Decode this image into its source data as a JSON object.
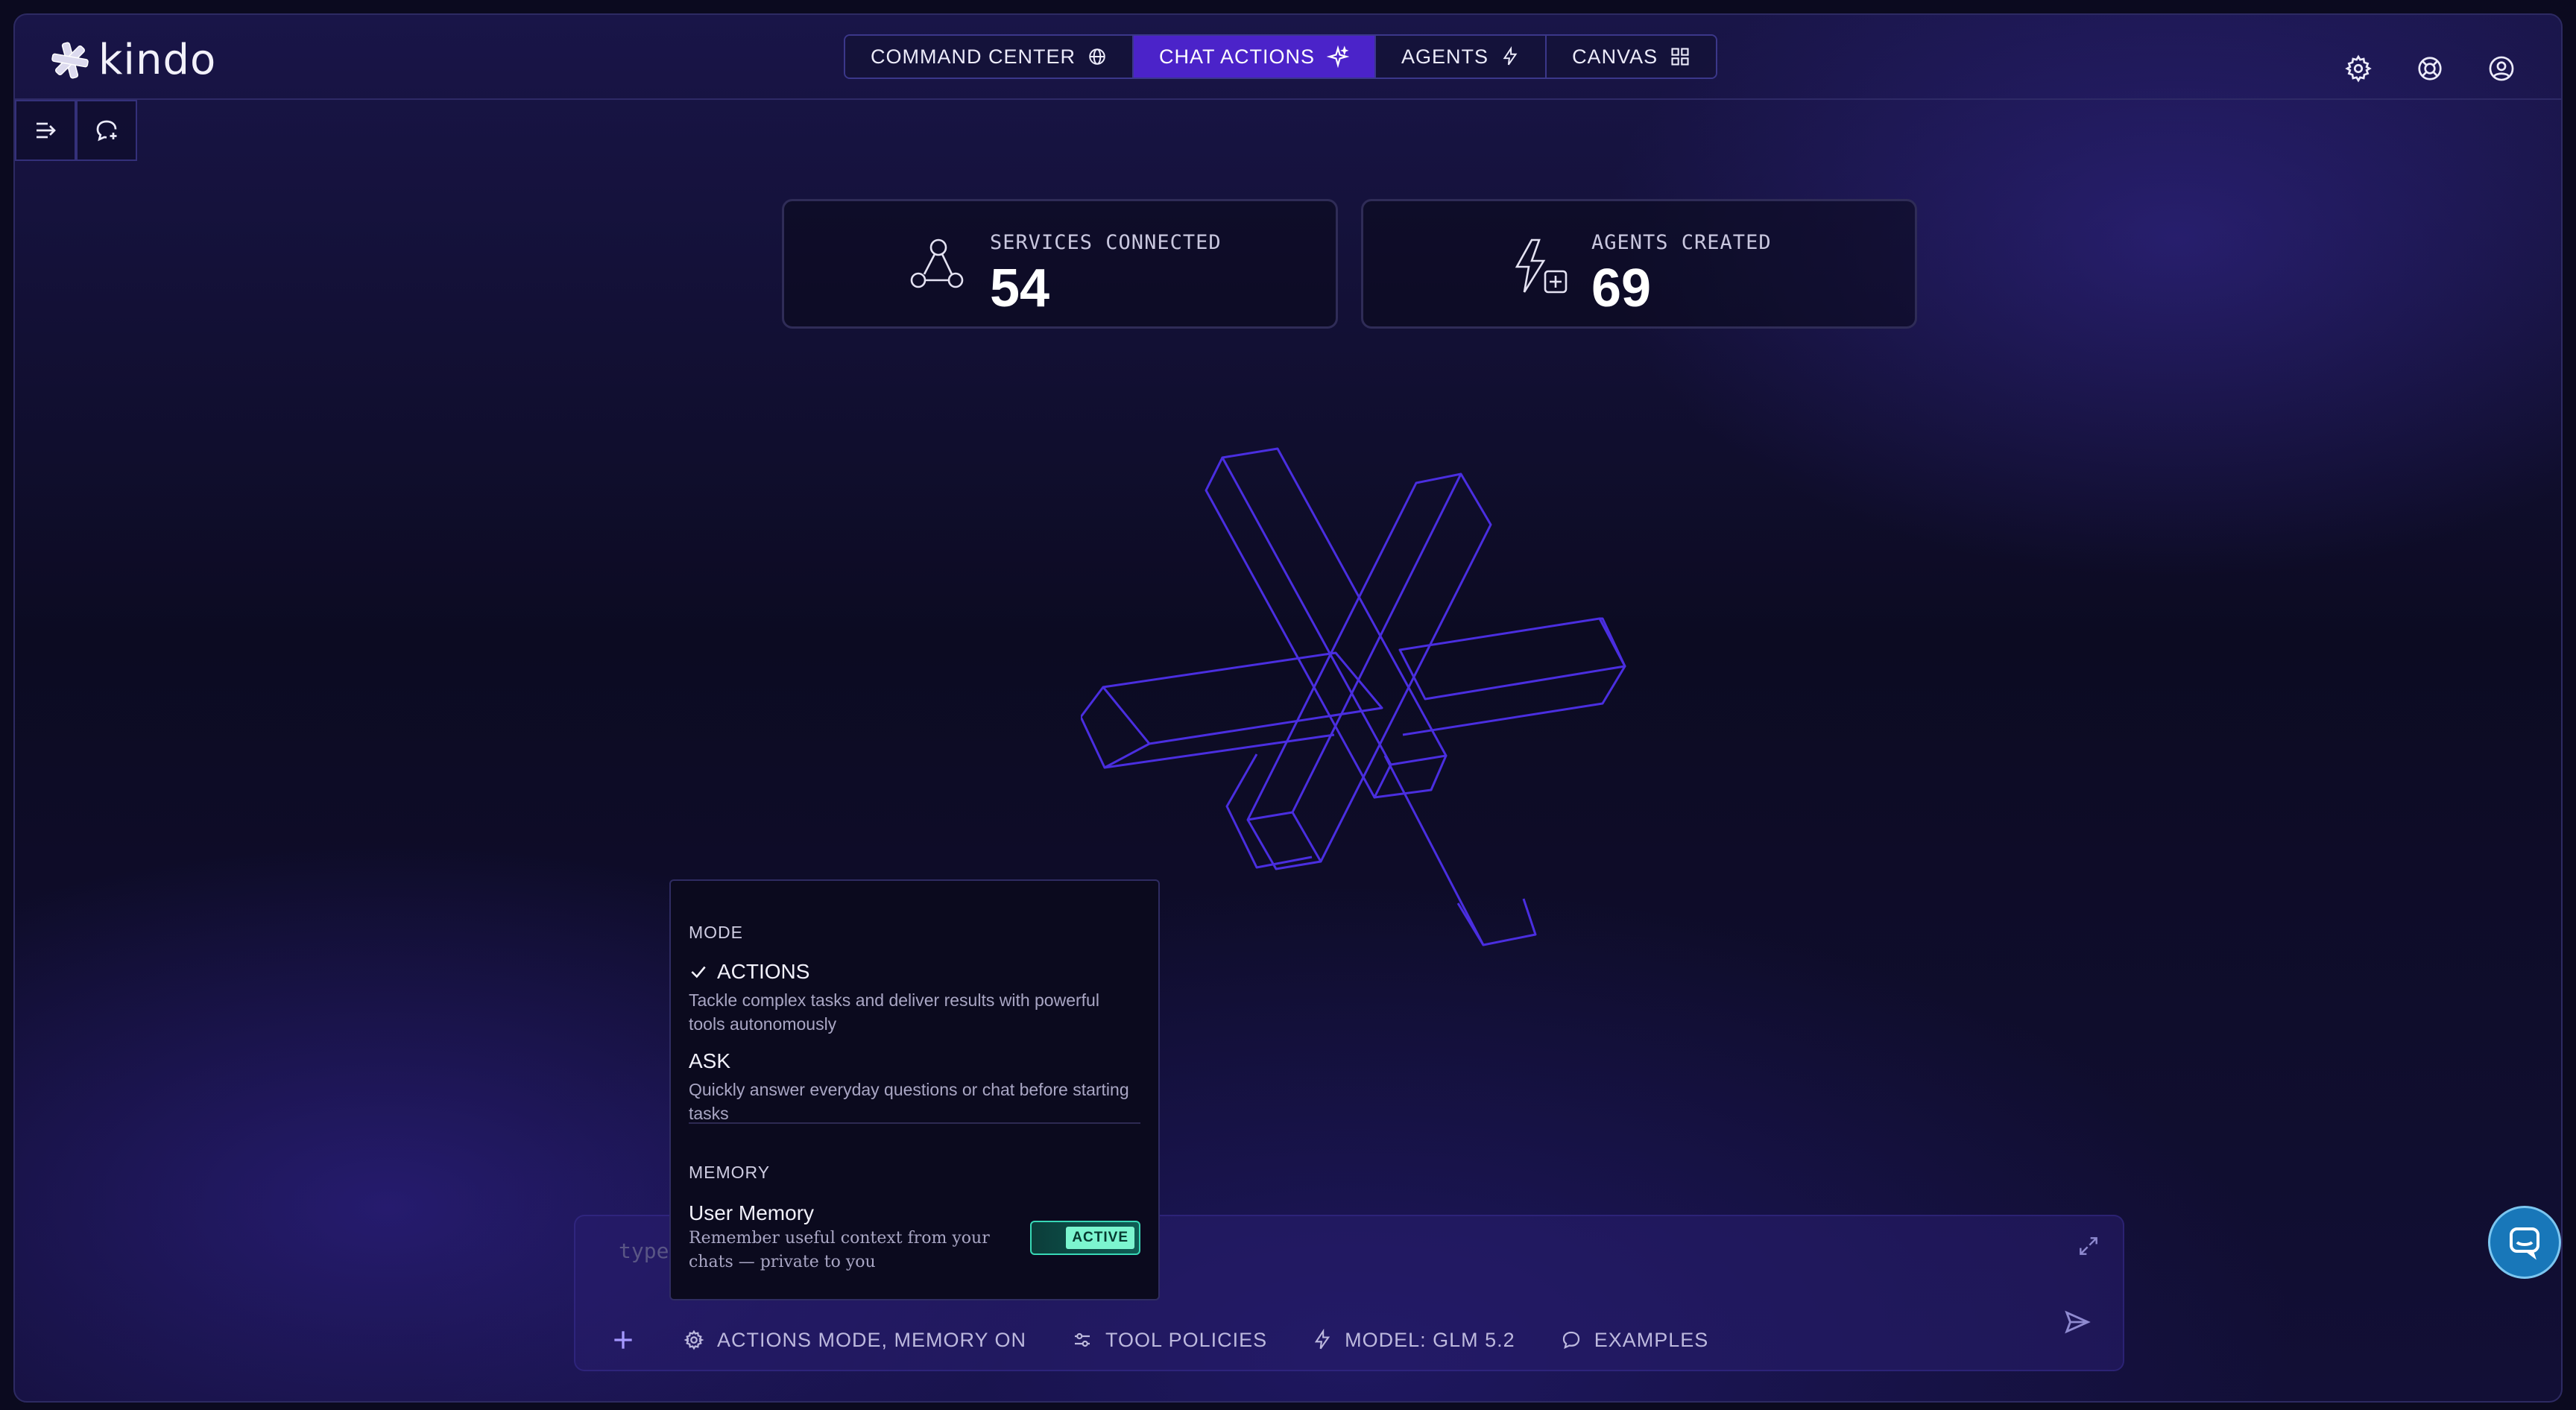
{
  "brand": {
    "logo_text": "kindo"
  },
  "nav": {
    "tabs": [
      {
        "label": "COMMAND CENTER",
        "icon": "globe-icon"
      },
      {
        "label": "CHAT ACTIONS",
        "icon": "sparkle-icon",
        "active": true
      },
      {
        "label": "AGENTS",
        "icon": "lightning-icon"
      },
      {
        "label": "CANVAS",
        "icon": "grid-icon"
      }
    ]
  },
  "header_icons": [
    "gear-icon",
    "lifebuoy-icon",
    "user-circle-icon"
  ],
  "sidebar_buttons": [
    "expand-sidebar-icon",
    "new-chat-icon"
  ],
  "stats": [
    {
      "label": "SERVICES CONNECTED",
      "value": "54",
      "icon": "services-graph-icon"
    },
    {
      "label": "AGENTS CREATED",
      "value": "69",
      "icon": "agent-add-icon"
    }
  ],
  "mode_menu": {
    "mode_title": "MODE",
    "options": [
      {
        "title": "ACTIONS",
        "selected": true,
        "description": "Tackle complex tasks and deliver results with powerful tools autonomously"
      },
      {
        "title": "ASK",
        "selected": false,
        "description": "Quickly answer everyday questions or chat before starting tasks"
      }
    ],
    "memory_title": "MEMORY",
    "memory": {
      "title": "User Memory",
      "description": "Remember useful context from your chats — private to you",
      "badge": "ACTIVE"
    }
  },
  "composer": {
    "placeholder": "type",
    "toolbar": {
      "mode": "ACTIONS MODE, MEMORY ON",
      "policies": "TOOL POLICIES",
      "model": "MODEL: GLM 5.2",
      "examples": "EXAMPLES"
    }
  },
  "colors": {
    "accent": "#4b23c9",
    "toggle": "#38d8b6",
    "help": "#1877b9",
    "outline": "#4a2ee0"
  }
}
